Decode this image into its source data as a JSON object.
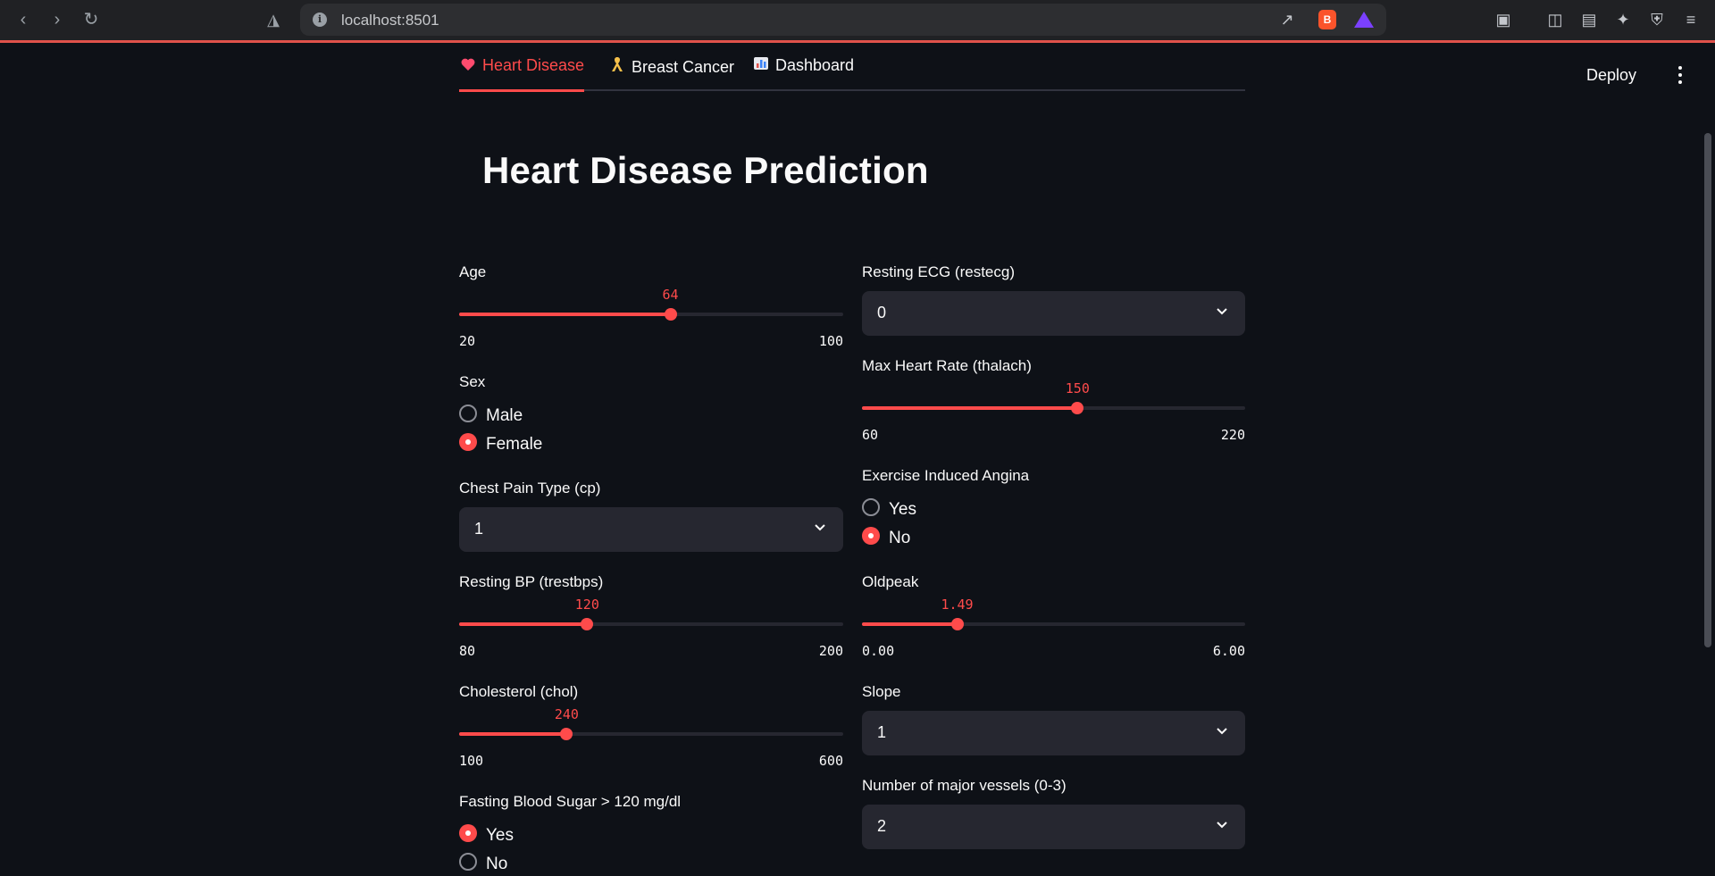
{
  "browser": {
    "url": "localhost:8501"
  },
  "header": {
    "deploy_label": "Deploy"
  },
  "tabs": [
    {
      "label": "Heart Disease",
      "icon": "heart-icon",
      "active": true
    },
    {
      "label": "Breast Cancer",
      "icon": "ribbon-icon",
      "active": false
    },
    {
      "label": "Dashboard",
      "icon": "bar-chart-icon",
      "active": false
    }
  ],
  "page": {
    "title": "Heart Disease Prediction"
  },
  "left": {
    "age": {
      "label": "Age",
      "value": "64",
      "min": "20",
      "max": "100"
    },
    "sex": {
      "label": "Sex",
      "options": [
        "Male",
        "Female"
      ],
      "selected": "Female"
    },
    "cp": {
      "label": "Chest Pain Type (cp)",
      "value": "1"
    },
    "trestbps": {
      "label": "Resting BP (trestbps)",
      "value": "120",
      "min": "80",
      "max": "200"
    },
    "chol": {
      "label": "Cholesterol (chol)",
      "value": "240",
      "min": "100",
      "max": "600"
    },
    "fbs": {
      "label": "Fasting Blood Sugar > 120 mg/dl",
      "options": [
        "Yes",
        "No"
      ],
      "selected": "Yes"
    }
  },
  "right": {
    "restecg": {
      "label": "Resting ECG (restecg)",
      "value": "0"
    },
    "thalach": {
      "label": "Max Heart Rate (thalach)",
      "value": "150",
      "min": "60",
      "max": "220"
    },
    "exang": {
      "label": "Exercise Induced Angina",
      "options": [
        "Yes",
        "No"
      ],
      "selected": "No"
    },
    "oldpeak": {
      "label": "Oldpeak",
      "value": "1.49",
      "min": "0.00",
      "max": "6.00"
    },
    "slope": {
      "label": "Slope",
      "value": "1"
    },
    "ca": {
      "label": "Number of major vessels (0-3)",
      "value": "2"
    }
  },
  "colors": {
    "accent": "#ff4b4b",
    "background": "#0e1117",
    "widget": "#262730"
  }
}
